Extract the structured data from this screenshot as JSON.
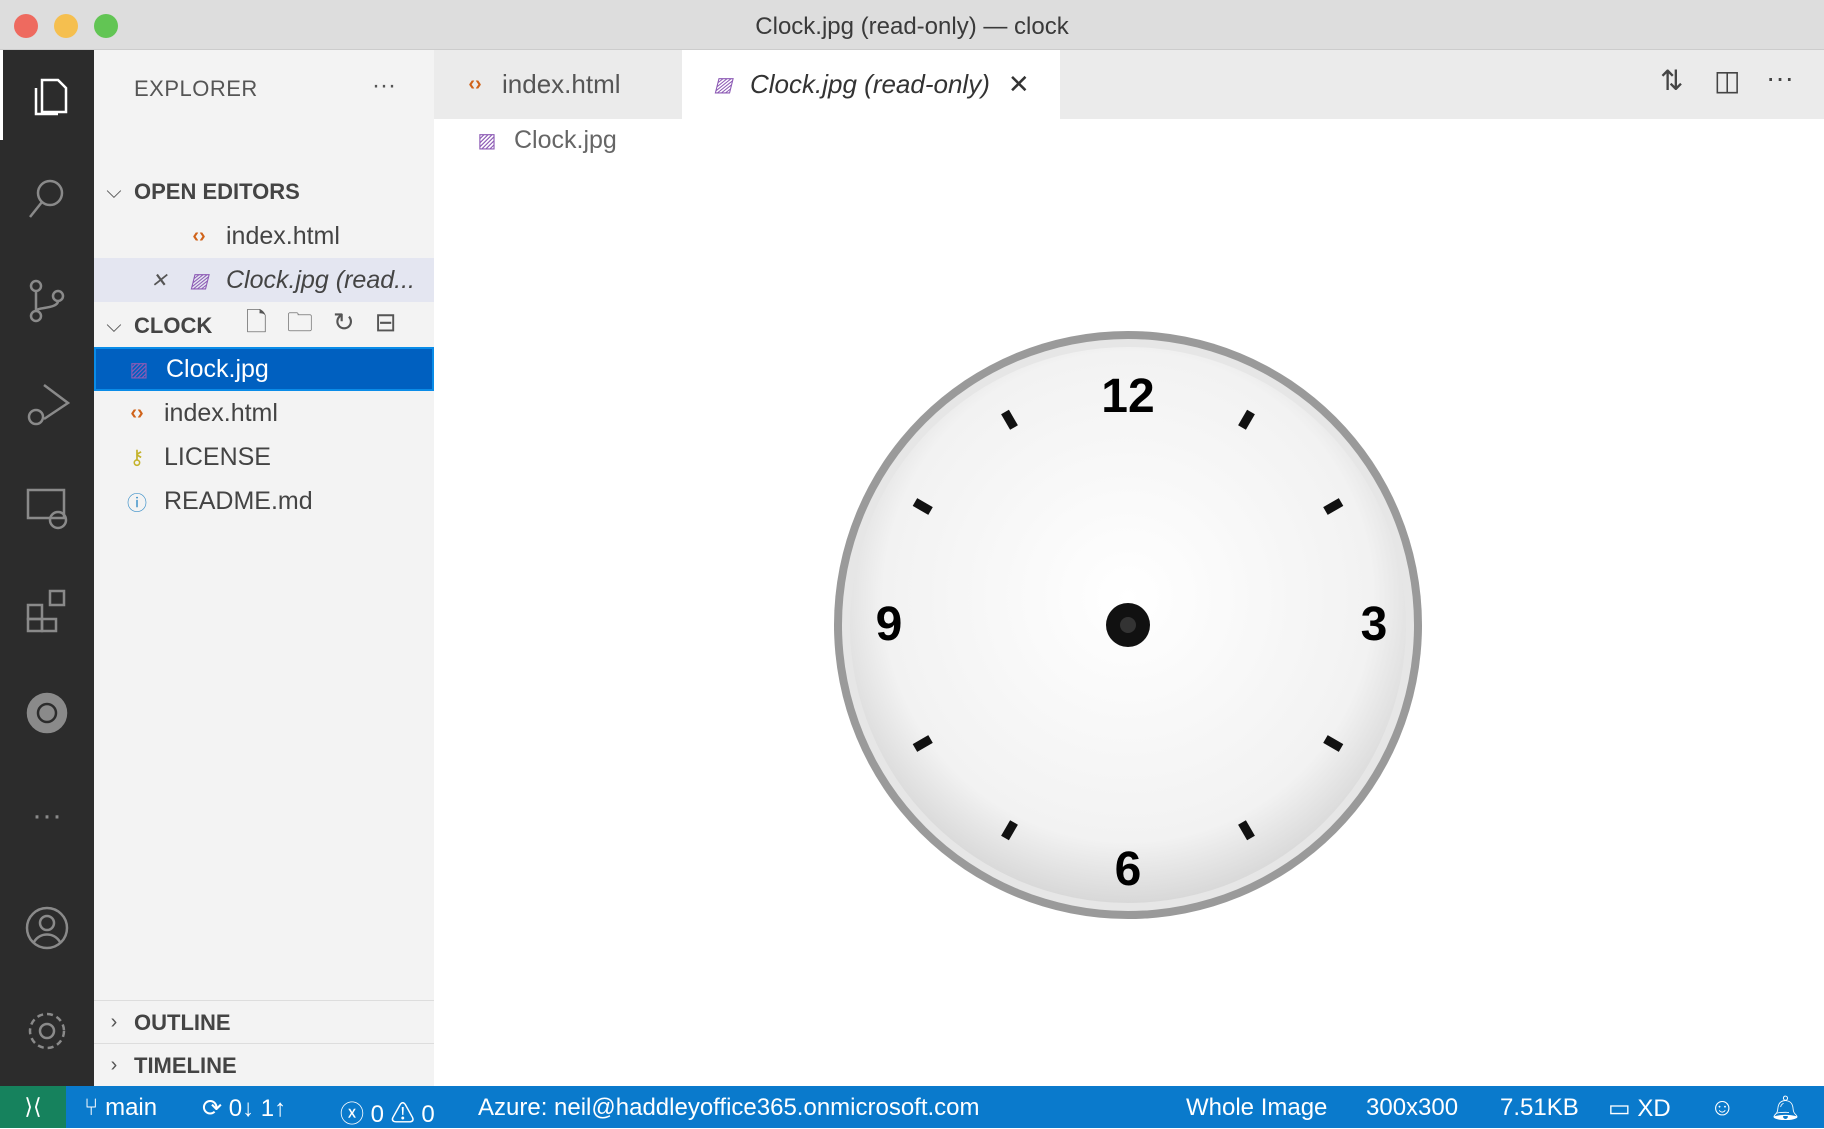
{
  "window": {
    "title": "Clock.jpg (read-only) — clock"
  },
  "activity_bar": [
    "explorer",
    "search",
    "source-control",
    "run-debug",
    "remote-explorer",
    "extensions",
    "kubernetes",
    "more",
    "accounts",
    "manage"
  ],
  "sidebar": {
    "title": "EXPLORER",
    "more": "···",
    "open_editors": {
      "label": "OPEN EDITORS",
      "items": [
        {
          "name": "index.html"
        },
        {
          "name": "Clock.jpg (read..."
        }
      ]
    },
    "folder": {
      "label": "CLOCK",
      "items": [
        {
          "name": "Clock.jpg"
        },
        {
          "name": "index.html"
        },
        {
          "name": "LICENSE"
        },
        {
          "name": "README.md"
        }
      ]
    },
    "outline": "OUTLINE",
    "timeline": "TIMELINE"
  },
  "tabs": [
    {
      "label": "index.html"
    },
    {
      "label": "Clock.jpg (read-only)",
      "active": true
    }
  ],
  "breadcrumb": "Clock.jpg",
  "clock": {
    "numbers": [
      "12",
      "3",
      "6",
      "9"
    ]
  },
  "status": {
    "branch": "main",
    "sync": "0↓ 1↑",
    "errors": "0",
    "warnings": "0",
    "azure": "Azure: neil@haddleyoffice365.onmicrosoft.com",
    "zoom": "Whole Image",
    "dimensions": "300x300",
    "size": "7.51KB",
    "xd": "XD"
  },
  "colors": {
    "accent": "#0a7acc",
    "selection": "#0060c0"
  }
}
